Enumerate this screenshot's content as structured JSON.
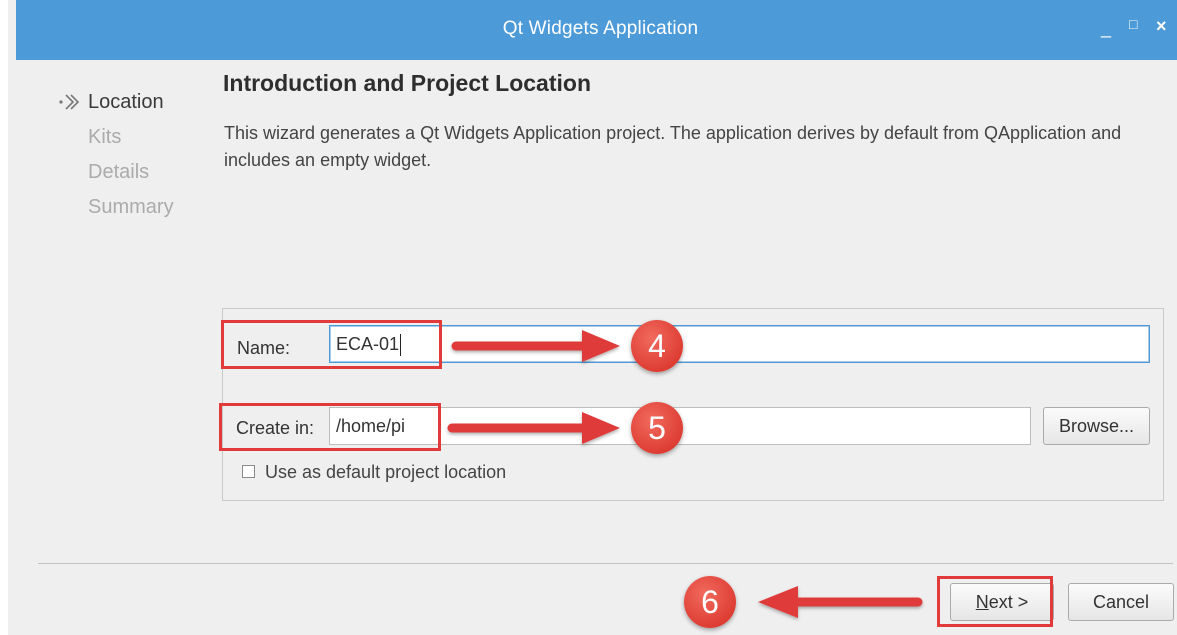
{
  "window": {
    "title": "Qt Widgets Application",
    "controls": {
      "minimize": "_",
      "maximize": "□",
      "close": "×"
    }
  },
  "nav": {
    "items": [
      {
        "label": "Location",
        "active": true
      },
      {
        "label": "Kits",
        "active": false
      },
      {
        "label": "Details",
        "active": false
      },
      {
        "label": "Summary",
        "active": false
      }
    ]
  },
  "page": {
    "heading": "Introduction and Project Location",
    "description": "This wizard generates a Qt Widgets Application project. The application derives by default from QApplication and includes an empty widget."
  },
  "form": {
    "name_label": "Name:",
    "name_value": "ECA-01",
    "create_in_label": "Create in:",
    "create_in_value": "/home/pi",
    "browse_label": "Browse...",
    "default_location_label": "Use as default project location",
    "default_location_checked": false
  },
  "buttons": {
    "next_mnemonic": "N",
    "next_rest": "ext >",
    "cancel_label": "Cancel"
  },
  "annotations": {
    "badge_name": "4",
    "badge_create": "5",
    "badge_next": "6",
    "color": "#e03a3a"
  },
  "colors": {
    "titlebar": "#4d9ad9",
    "background": "#efefef",
    "focus_border": "#4d9ad9"
  }
}
